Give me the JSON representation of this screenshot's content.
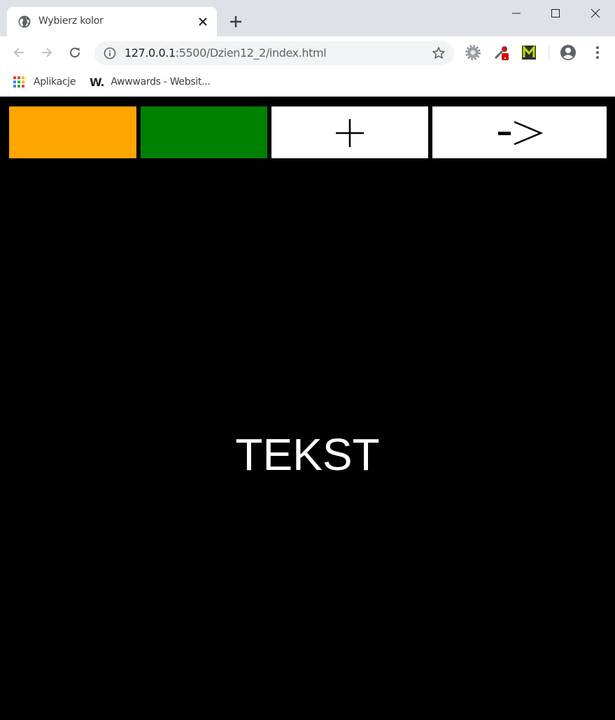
{
  "browser": {
    "tab_title": "Wybierz kolor",
    "url_host": "127.0.0.1",
    "url_path": ":5500/Dzien12_2/index.html",
    "bookmarks": [
      {
        "label": "Aplikacje",
        "icon": "apps-grid-icon"
      },
      {
        "label": "Awwwards - Websit...",
        "icon": "w-logo-icon"
      }
    ],
    "awwwards_logo": "W."
  },
  "page": {
    "buttons": [
      {
        "name": "orange",
        "color": "#ffa500"
      },
      {
        "name": "green",
        "color": "#008000"
      },
      {
        "name": "plus",
        "icon": "plus-icon"
      },
      {
        "name": "arrow",
        "icon": "arrow-right-icon"
      }
    ],
    "text": "TEKST",
    "background": "#000000"
  }
}
